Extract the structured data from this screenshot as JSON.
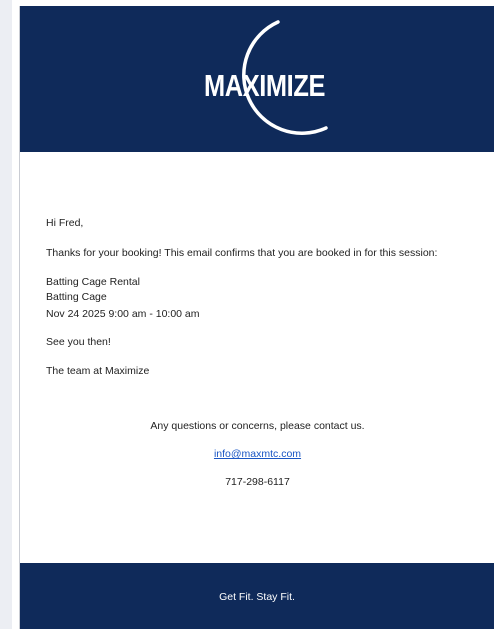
{
  "header": {
    "logo_text": "MAXIMIZE",
    "brand_color": "#0f2a5a"
  },
  "message": {
    "greeting": "Hi Fred,",
    "intro": "Thanks for your booking! This email confirms that you are booked in for this session:",
    "session": {
      "name": "Batting Cage Rental",
      "resource": "Batting Cage",
      "datetime": "Nov 24 2025 9:00 am - 10:00 am"
    },
    "closing": "See you then!",
    "signoff": "The team at Maximize"
  },
  "contact": {
    "prompt": "Any questions or concerns, please contact us.",
    "email": "info@maxmtc.com",
    "link_color": "#1a56c4",
    "phone": "717-298-6117"
  },
  "footer": {
    "tagline": "Get Fit. Stay Fit."
  }
}
